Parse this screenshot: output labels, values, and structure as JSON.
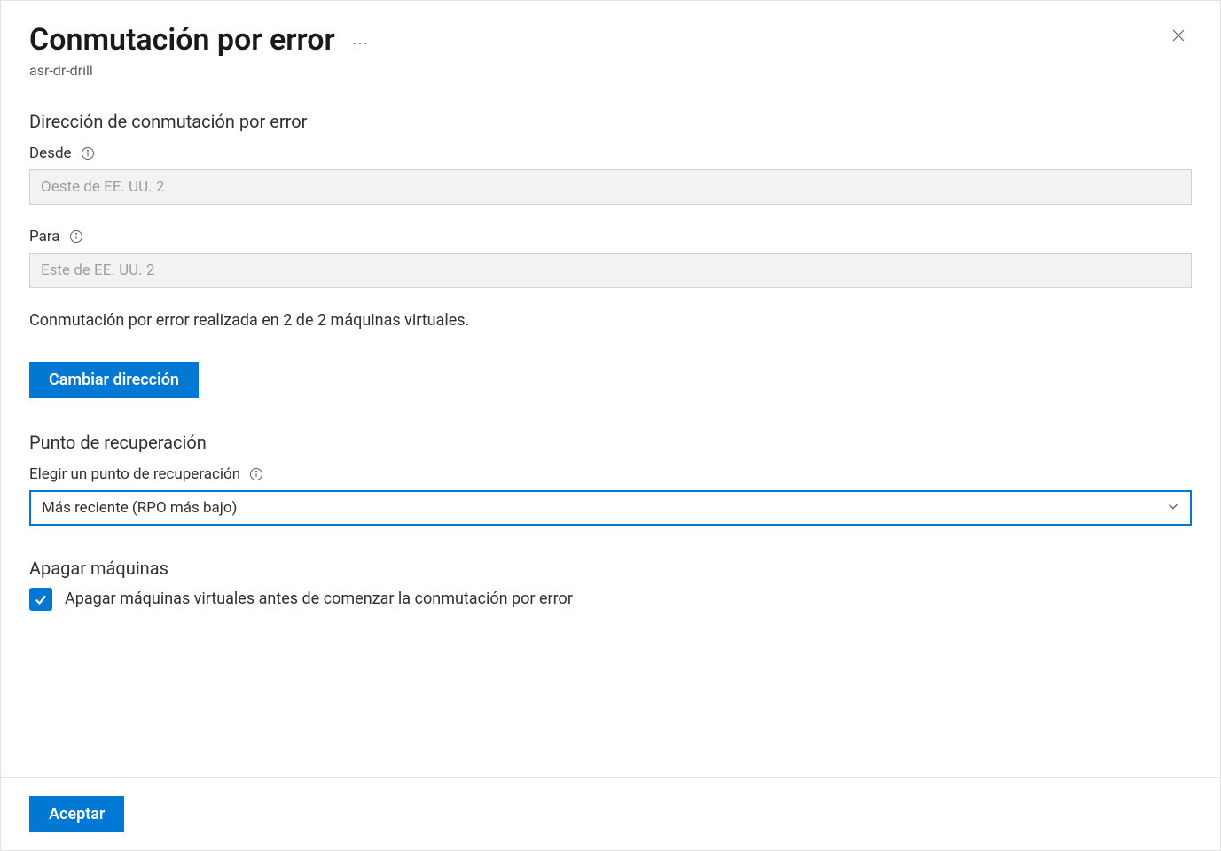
{
  "header": {
    "title": "Conmutación por error",
    "subtitle": "asr-dr-drill"
  },
  "direction": {
    "heading": "Dirección de conmutación por error",
    "from_label": "Desde",
    "from_value": "Oeste de EE. UU. 2",
    "to_label": "Para",
    "to_value": "Este de EE. UU. 2",
    "status": "Conmutación por error realizada en 2 de 2 máquinas virtuales.",
    "change_button": "Cambiar dirección"
  },
  "recovery": {
    "heading": "Punto de recuperación",
    "choose_label": "Elegir un punto de recuperación",
    "selected": "Más reciente (RPO más bajo)"
  },
  "shutdown": {
    "heading": "Apagar máquinas",
    "checkbox_label": "Apagar máquinas virtuales antes de comenzar la conmutación por error"
  },
  "footer": {
    "accept": "Aceptar"
  }
}
